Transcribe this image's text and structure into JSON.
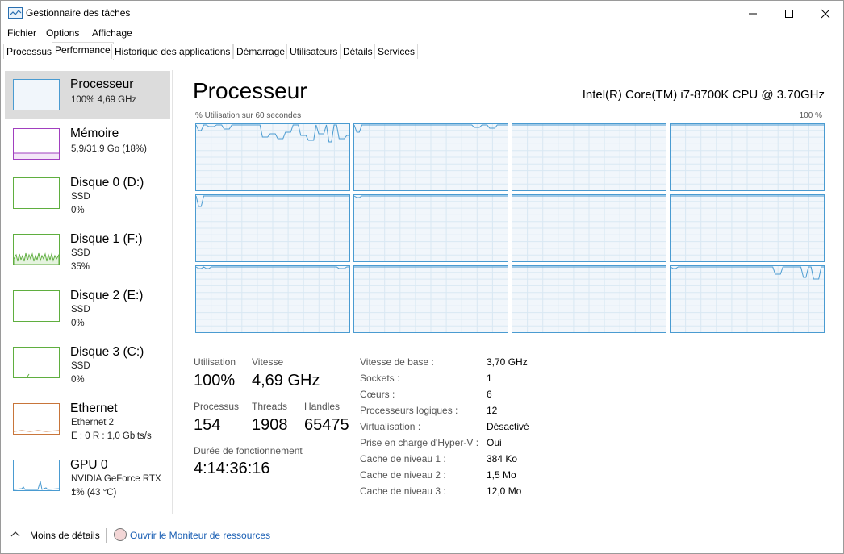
{
  "window": {
    "title": "Gestionnaire des tâches",
    "controls": [
      "minimize",
      "maximize",
      "close"
    ]
  },
  "menu": [
    "Fichier",
    "Options",
    "Affichage"
  ],
  "tabs": [
    {
      "label": "Processus"
    },
    {
      "label": "Performance",
      "active": true
    },
    {
      "label": "Historique des applications"
    },
    {
      "label": "Démarrage"
    },
    {
      "label": "Utilisateurs"
    },
    {
      "label": "Détails"
    },
    {
      "label": "Services"
    }
  ],
  "sidebar": {
    "items": [
      {
        "title": "Processeur",
        "line1": "100%  4,69 GHz",
        "line2": "",
        "color": "#4a9bd1",
        "selected": true
      },
      {
        "title": "Mémoire",
        "line1": "5,9/31,9 Go (18%)",
        "line2": "",
        "color": "#a13fbf"
      },
      {
        "title": "Disque 0 (D:)",
        "line1": "SSD",
        "line2": "0%",
        "color": "#5fae3f"
      },
      {
        "title": "Disque 1 (F:)",
        "line1": "SSD",
        "line2": "35%",
        "color": "#5fae3f"
      },
      {
        "title": "Disque 2 (E:)",
        "line1": "SSD",
        "line2": "0%",
        "color": "#5fae3f"
      },
      {
        "title": "Disque 3 (C:)",
        "line1": "SSD",
        "line2": "0%",
        "color": "#5fae3f"
      },
      {
        "title": "Ethernet",
        "line1": "Ethernet 2",
        "line2": "E : 0 R : 1,0 Gbits/s",
        "color": "#c8753a"
      },
      {
        "title": "GPU 0",
        "line1": "NVIDIA GeForce RTX ...",
        "line2": "1% (43 °C)",
        "color": "#4a9bd1"
      }
    ]
  },
  "main": {
    "title": "Processeur",
    "cpu_name": "Intel(R) Core(TM) i7-8700K CPU @ 3.70GHz",
    "graph_label_left": "% Utilisation sur 60 secondes",
    "graph_label_right": "100 %",
    "stats": {
      "utilisation_label": "Utilisation",
      "utilisation_value": "100%",
      "vitesse_label": "Vitesse",
      "vitesse_value": "4,69 GHz",
      "processus_label": "Processus",
      "processus_value": "154",
      "threads_label": "Threads",
      "threads_value": "1908",
      "handles_label": "Handles",
      "handles_value": "65475",
      "uptime_label": "Durée de fonctionnement",
      "uptime_value": "4:14:36:16"
    },
    "info": [
      {
        "label": "Vitesse de base :",
        "value": "3,70 GHz"
      },
      {
        "label": "Sockets :",
        "value": "1"
      },
      {
        "label": "Cœurs :",
        "value": "6"
      },
      {
        "label": "Processeurs logiques :",
        "value": "12"
      },
      {
        "label": "Virtualisation :",
        "value": "Désactivé"
      },
      {
        "label": "Prise en charge d'Hyper-V :",
        "value": "Oui"
      },
      {
        "label": "Cache de niveau 1 :",
        "value": "384 Ko"
      },
      {
        "label": "Cache de niveau 2 :",
        "value": "1,5 Mo"
      },
      {
        "label": "Cache de niveau 3 :",
        "value": "12,0 Mo"
      }
    ]
  },
  "footer": {
    "fewer_details": "Moins de détails",
    "resource_monitor": "Ouvrir le Moniteur de ressources"
  },
  "colors": {
    "cpu_line": "#4a9bd1",
    "cpu_fill": "#f1f6fb",
    "grid": "#d9e8f3"
  }
}
